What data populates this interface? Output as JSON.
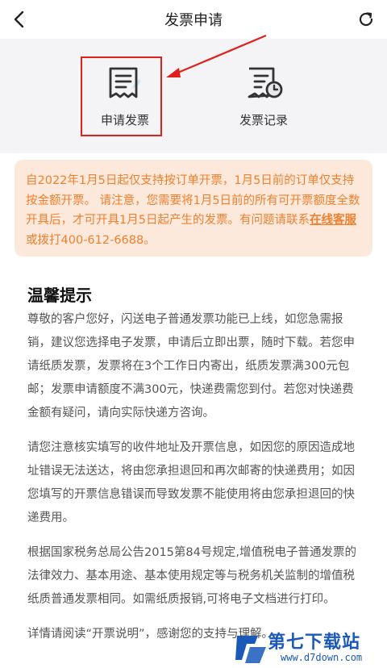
{
  "header": {
    "title": "发票申请"
  },
  "actions": {
    "apply_label": "申请发票",
    "records_label": "发票记录"
  },
  "notice": {
    "text_before": "自2022年1月5日起仅支持按订单开票，1月5日前的订单仅支持按金额开票。 请注意，您需要将1月5日前的所有可开票额度全数开具后，才可开具1月5日起产生的发票。有问题请联系",
    "link": "在线客服",
    "text_after": "或拨打400-612-6688。"
  },
  "tips": {
    "title": "温馨提示",
    "paragraphs": [
      "尊敬的客户您好，闪送电子普通发票功能已上线，如您急需报销，建议您选择电子发票，申请后立即出票，随时下载。若您申请纸质发票，发票将在3个工作日内寄出，纸质发票满300元包邮；发票申请额度不满300元，快递费需您到付。若您对快递费金额有疑问，请向实际快递方咨询。",
      "请您注意核实填写的收件地址及开票信息，如因您的原因造成地址错误无法送达，将由您承担退回和再次邮寄的快递费用；如因您填写的开票信息错误而导致发票不能使用将由您承担退回的快递费用。",
      "根据国家税务总局公告2015第84号规定,增值税电子普通发票的法律效力、基本用途、基本使用规定等与税务机关监制的增值税纸质普通发票相同。如需纸质报销,可将电子文档进行打印。",
      "详情请阅读“开票说明”，感谢您的支持与理解。"
    ]
  },
  "watermark": {
    "name": "第七下载站",
    "url": "www.d7down.com"
  },
  "icons": {
    "back": "chevron-left-icon",
    "refresh": "refresh-icon",
    "apply": "receipt-icon",
    "records": "receipt-clock-icon"
  },
  "colors": {
    "notice_text": "#f0802e",
    "notice_bg": "#fde9dc",
    "highlight": "#e0221d",
    "watermark": "#1a59b8"
  }
}
